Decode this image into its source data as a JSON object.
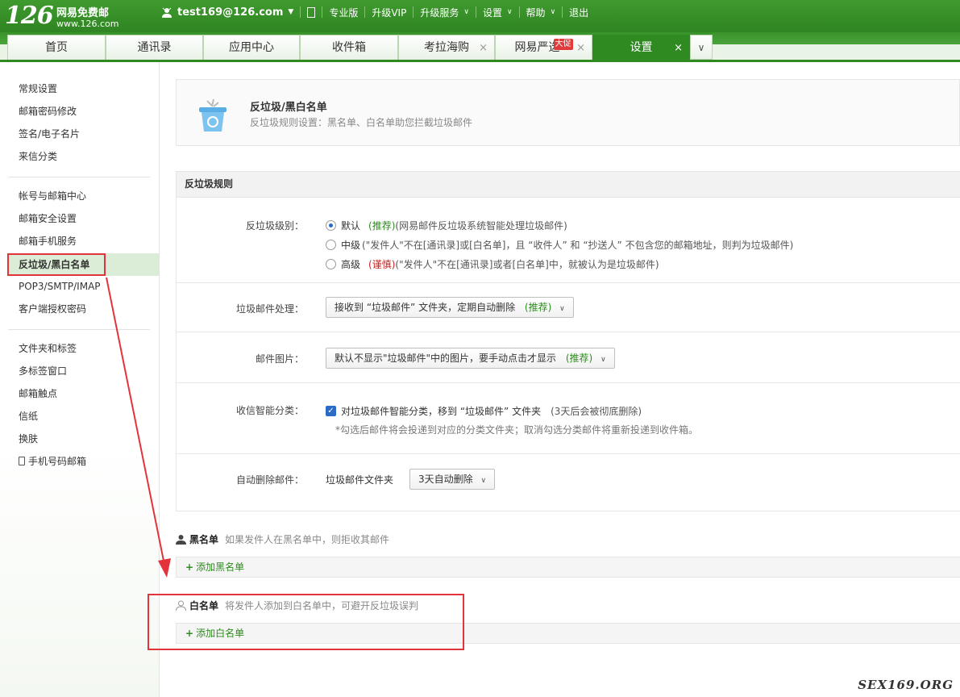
{
  "brand": {
    "logo": "126",
    "name": "网易免费邮",
    "url": "www.126.com"
  },
  "userbar": {
    "email": "test169@126.com",
    "links": [
      "专业版",
      "升级VIP",
      "升级服务",
      "设置",
      "帮助",
      "退出"
    ]
  },
  "tabs": [
    {
      "label": "首页"
    },
    {
      "label": "通讯录"
    },
    {
      "label": "应用中心"
    },
    {
      "label": "收件箱"
    },
    {
      "label": "考拉海购"
    },
    {
      "label": "网易严选",
      "badge": "大促"
    },
    {
      "label": "设置"
    }
  ],
  "sidebar": {
    "group1": [
      "常规设置",
      "邮箱密码修改",
      "签名/电子名片",
      "来信分类"
    ],
    "group2": [
      "帐号与邮箱中心",
      "邮箱安全设置",
      "邮箱手机服务",
      "反垃圾/黑白名单",
      "POP3/SMTP/IMAP",
      "客户端授权密码"
    ],
    "group3": [
      "文件夹和标签",
      "多标签窗口",
      "邮箱触点",
      "信纸",
      "换肤",
      "手机号码邮箱"
    ]
  },
  "header": {
    "title": "反垃圾/黑白名单",
    "desc": "反垃圾规则设置：黑名单、白名单助您拦截垃圾邮件"
  },
  "rules": {
    "title": "反垃圾规则",
    "level_label": "反垃圾级别：",
    "levels": [
      {
        "name": "默认",
        "tag": "(推荐)",
        "desc": "(网易邮件反垃圾系统智能处理垃圾邮件)"
      },
      {
        "name": "中级",
        "tag": "",
        "desc": "(\"发件人\"不在[通讯录]或[白名单]，且 “收件人” 和 “抄送人” 不包含您的邮箱地址，则判为垃圾邮件)"
      },
      {
        "name": "高级",
        "tag": "(谨慎)",
        "desc": "(\"发件人\"不在[通讯录]或者[白名单]中，就被认为是垃圾邮件)"
      }
    ],
    "handling_label": "垃圾邮件处理：",
    "handling_value": "接收到 “垃圾邮件” 文件夹，定期自动删除",
    "handling_tag": "(推荐)",
    "image_label": "邮件图片：",
    "image_value": "默认不显示\"垃圾邮件\"中的图片，要手动点击才显示",
    "image_tag": "(推荐)",
    "classify_label": "收信智能分类：",
    "classify_text": "对垃圾邮件智能分类，移到 “垃圾邮件” 文件夹",
    "classify_note": "(3天后会被彻底删除)",
    "classify_hint": "*勾选后邮件将会投递到对应的分类文件夹；取消勾选分类邮件将重新投递到收件箱。",
    "autodel_label": "自动删除邮件：",
    "autodel_folder": "垃圾邮件文件夹",
    "autodel_value": "3天自动删除"
  },
  "blacklist": {
    "title": "黑名单",
    "desc": "如果发件人在黑名单中，则拒收其邮件",
    "add": "添加黑名单"
  },
  "whitelist": {
    "title": "白名单",
    "desc": "将发件人添加到白名单中，可避开反垃圾误判",
    "add": "添加白名单"
  },
  "watermark": "SEX169.ORG",
  "colors": {
    "brand_green": "#2f8a22",
    "annotation_red": "#e3343b",
    "link_green": "#2e8b1f"
  },
  "icons": [
    "user-icon",
    "trash-bin-icon",
    "person-icon",
    "phone-icon",
    "close-icon",
    "chevron-down-icon"
  ]
}
